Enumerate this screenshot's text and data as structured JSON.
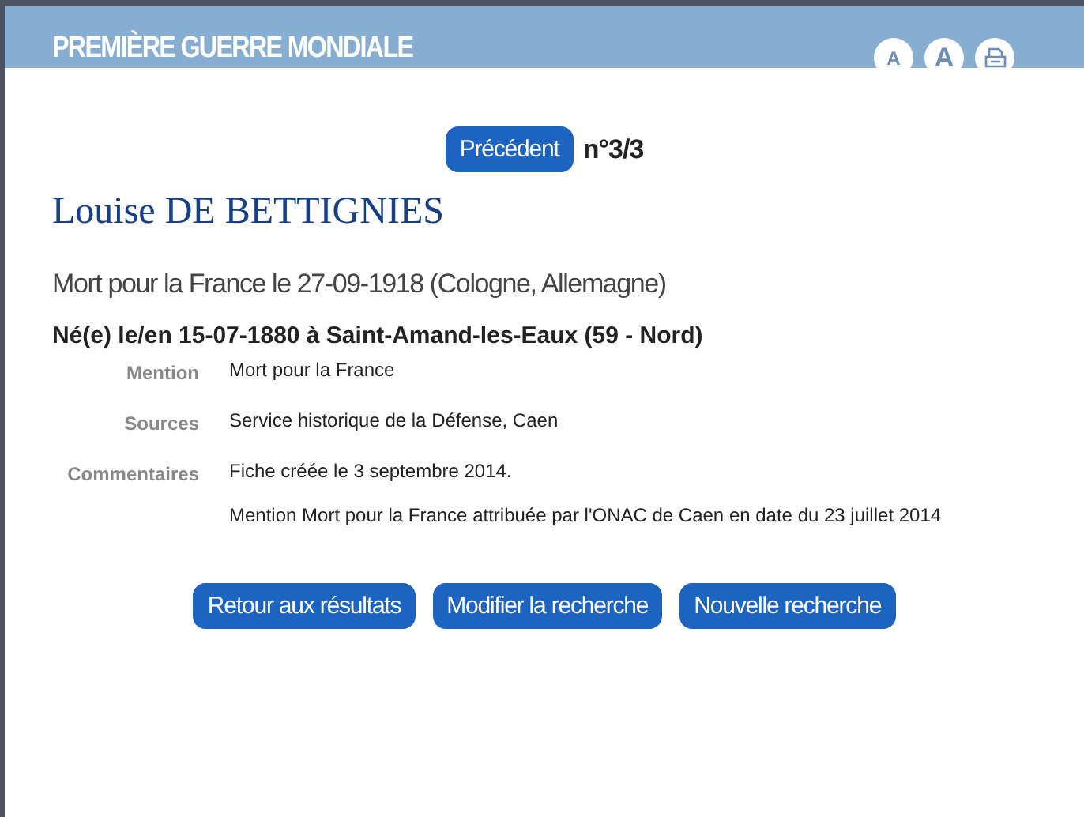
{
  "header": {
    "title": "PREMIÈRE GUERRE MONDIALE",
    "tools": [
      {
        "kind": "font-small",
        "label": "A"
      },
      {
        "kind": "font-large",
        "label": "A"
      },
      {
        "kind": "print"
      }
    ]
  },
  "nav": {
    "previous": "Précédent",
    "counter": "n°3/3"
  },
  "person": {
    "name": "Louise DE BETTIGNIES",
    "death": "Mort pour la France le 27-09-1918 (Cologne, Allemagne)",
    "birth": "Né(e) le/en 15-07-1880 à Saint-Amand-les-Eaux (59 - Nord)"
  },
  "details": [
    {
      "label": "Mention",
      "values": [
        "Mort pour la France"
      ]
    },
    {
      "label": "Sources",
      "values": [
        "Service historique de la Défense, Caen"
      ]
    },
    {
      "label": "Commentaires",
      "values": [
        "Fiche créée le 3 septembre 2014.",
        "Mention Mort pour la France attribuée par l'ONAC de Caen en date du 23 juillet 2014"
      ]
    }
  ],
  "actions": [
    "Retour aux résultats",
    "Modifier la recherche",
    "Nouvelle recherche"
  ]
}
